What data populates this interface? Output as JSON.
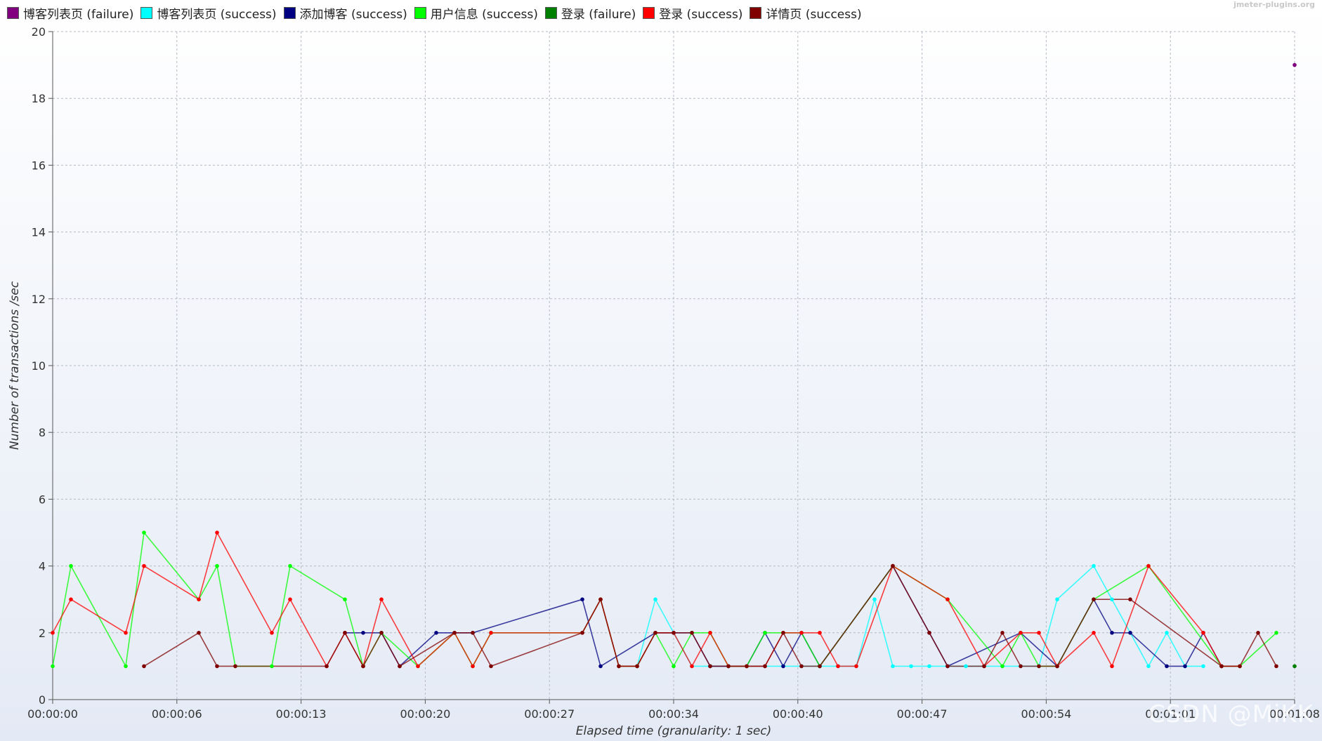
{
  "credit": "jmeter-plugins.org",
  "watermark": "CSDN @MiKK",
  "chart_data": {
    "type": "line",
    "xlabel": "Elapsed time (granularity: 1 sec)",
    "ylabel": "Number of transactions /sec",
    "xlim": [
      0,
      68
    ],
    "ylim": [
      0,
      20
    ],
    "y_ticks": [
      0,
      2,
      4,
      6,
      8,
      10,
      12,
      14,
      16,
      18,
      20
    ],
    "x_ticks": [
      {
        "value": 0,
        "label": "00:00:00"
      },
      {
        "value": 6.8,
        "label": "00:00:06"
      },
      {
        "value": 13.6,
        "label": "00:00:13"
      },
      {
        "value": 20.4,
        "label": "00:00:20"
      },
      {
        "value": 27.2,
        "label": "00:00:27"
      },
      {
        "value": 34.0,
        "label": "00:00:34"
      },
      {
        "value": 40.8,
        "label": "00:00:40"
      },
      {
        "value": 47.6,
        "label": "00:00:47"
      },
      {
        "value": 54.4,
        "label": "00:00:54"
      },
      {
        "value": 61.2,
        "label": "00:01:01"
      },
      {
        "value": 68.0,
        "label": "00:01:08"
      }
    ],
    "grid": true,
    "legend_position": "top-left",
    "series": [
      {
        "name": "博客列表页 (failure)",
        "color": "#800080",
        "points": [
          [
            68,
            19
          ]
        ]
      },
      {
        "name": "博客列表页 (success)",
        "color": "#00ffff",
        "points": [
          [
            32,
            1
          ],
          [
            33,
            3
          ],
          [
            34,
            2
          ],
          [
            35,
            1
          ],
          [
            36,
            1
          ],
          [
            37,
            1
          ],
          [
            38,
            1
          ],
          [
            39,
            1
          ],
          [
            40,
            1
          ],
          [
            41,
            1
          ],
          [
            42,
            1
          ],
          [
            43,
            1
          ],
          [
            44,
            1
          ],
          [
            45,
            3
          ],
          [
            46,
            1
          ],
          [
            47,
            1
          ],
          [
            48,
            1
          ],
          [
            49,
            1
          ],
          [
            50,
            1
          ],
          [
            51,
            1
          ],
          [
            52,
            1
          ],
          [
            53,
            1
          ],
          [
            54,
            1
          ],
          [
            55,
            3
          ],
          [
            57,
            4
          ],
          [
            58,
            3
          ],
          [
            60,
            1
          ],
          [
            61,
            2
          ],
          [
            62,
            1
          ],
          [
            63,
            1
          ]
        ]
      },
      {
        "name": "添加博客 (success)",
        "color": "#000080",
        "points": [
          [
            16,
            2
          ],
          [
            17,
            2
          ],
          [
            18,
            2
          ],
          [
            19,
            1
          ],
          [
            21,
            2
          ],
          [
            22,
            2
          ],
          [
            23,
            2
          ],
          [
            29,
            3
          ],
          [
            30,
            1
          ],
          [
            33,
            2
          ],
          [
            34,
            2
          ],
          [
            35,
            2
          ],
          [
            36,
            1
          ],
          [
            37,
            1
          ],
          [
            38,
            1
          ],
          [
            39,
            2
          ],
          [
            40,
            1
          ],
          [
            41,
            2
          ],
          [
            42,
            1
          ],
          [
            46,
            4
          ],
          [
            48,
            2
          ],
          [
            49,
            1
          ],
          [
            53,
            2
          ],
          [
            55,
            1
          ],
          [
            57,
            3
          ],
          [
            58,
            2
          ],
          [
            59,
            2
          ],
          [
            61,
            1
          ],
          [
            62,
            1
          ],
          [
            63,
            2
          ],
          [
            64,
            1
          ]
        ]
      },
      {
        "name": "用户信息 (success)",
        "color": "#00ff00",
        "points": [
          [
            0,
            1
          ],
          [
            1,
            4
          ],
          [
            4,
            1
          ],
          [
            5,
            5
          ],
          [
            8,
            3
          ],
          [
            9,
            4
          ],
          [
            10,
            1
          ],
          [
            12,
            1
          ],
          [
            13,
            4
          ],
          [
            16,
            3
          ],
          [
            17,
            1
          ],
          [
            18,
            2
          ],
          [
            20,
            1
          ],
          [
            22,
            2
          ],
          [
            23,
            1
          ],
          [
            24,
            2
          ],
          [
            29,
            2
          ],
          [
            30,
            3
          ],
          [
            31,
            1
          ],
          [
            32,
            1
          ],
          [
            33,
            2
          ],
          [
            34,
            1
          ],
          [
            35,
            2
          ],
          [
            36,
            2
          ],
          [
            37,
            1
          ],
          [
            38,
            1
          ],
          [
            39,
            2
          ],
          [
            40,
            2
          ],
          [
            41,
            2
          ],
          [
            42,
            1
          ],
          [
            46,
            4
          ],
          [
            49,
            3
          ],
          [
            52,
            1
          ],
          [
            53,
            2
          ],
          [
            54,
            1
          ],
          [
            55,
            1
          ],
          [
            57,
            3
          ],
          [
            60,
            4
          ],
          [
            64,
            1
          ],
          [
            65,
            1
          ],
          [
            67,
            2
          ]
        ]
      },
      {
        "name": "登录 (failure)",
        "color": "#008000",
        "points": [
          [
            68,
            1
          ]
        ]
      },
      {
        "name": "登录 (success)",
        "color": "#ff0000",
        "points": [
          [
            0,
            2
          ],
          [
            1,
            3
          ],
          [
            4,
            2
          ],
          [
            5,
            4
          ],
          [
            8,
            3
          ],
          [
            9,
            5
          ],
          [
            12,
            2
          ],
          [
            13,
            3
          ],
          [
            15,
            1
          ],
          [
            16,
            2
          ],
          [
            17,
            1
          ],
          [
            18,
            3
          ],
          [
            20,
            1
          ],
          [
            22,
            2
          ],
          [
            23,
            1
          ],
          [
            24,
            2
          ],
          [
            29,
            2
          ],
          [
            30,
            3
          ],
          [
            31,
            1
          ],
          [
            32,
            1
          ],
          [
            33,
            2
          ],
          [
            34,
            2
          ],
          [
            35,
            1
          ],
          [
            36,
            2
          ],
          [
            37,
            1
          ],
          [
            38,
            1
          ],
          [
            39,
            1
          ],
          [
            40,
            2
          ],
          [
            41,
            2
          ],
          [
            42,
            2
          ],
          [
            43,
            1
          ],
          [
            44,
            1
          ],
          [
            46,
            4
          ],
          [
            49,
            3
          ],
          [
            51,
            1
          ],
          [
            53,
            2
          ],
          [
            54,
            2
          ],
          [
            55,
            1
          ],
          [
            57,
            2
          ],
          [
            58,
            1
          ],
          [
            60,
            4
          ],
          [
            63,
            2
          ],
          [
            64,
            1
          ],
          [
            65,
            1
          ]
        ]
      },
      {
        "name": "详情页 (success)",
        "color": "#800000",
        "points": [
          [
            5,
            1
          ],
          [
            8,
            2
          ],
          [
            9,
            1
          ],
          [
            10,
            1
          ],
          [
            15,
            1
          ],
          [
            16,
            2
          ],
          [
            17,
            1
          ],
          [
            18,
            2
          ],
          [
            19,
            1
          ],
          [
            22,
            2
          ],
          [
            23,
            2
          ],
          [
            24,
            1
          ],
          [
            29,
            2
          ],
          [
            30,
            3
          ],
          [
            31,
            1
          ],
          [
            32,
            1
          ],
          [
            33,
            2
          ],
          [
            34,
            2
          ],
          [
            35,
            2
          ],
          [
            36,
            1
          ],
          [
            37,
            1
          ],
          [
            38,
            1
          ],
          [
            39,
            1
          ],
          [
            40,
            2
          ],
          [
            41,
            1
          ],
          [
            42,
            1
          ],
          [
            46,
            4
          ],
          [
            48,
            2
          ],
          [
            49,
            1
          ],
          [
            51,
            1
          ],
          [
            52,
            2
          ],
          [
            53,
            1
          ],
          [
            54,
            1
          ],
          [
            55,
            1
          ],
          [
            57,
            3
          ],
          [
            59,
            3
          ],
          [
            64,
            1
          ],
          [
            65,
            1
          ],
          [
            66,
            2
          ],
          [
            67,
            1
          ]
        ]
      }
    ]
  }
}
